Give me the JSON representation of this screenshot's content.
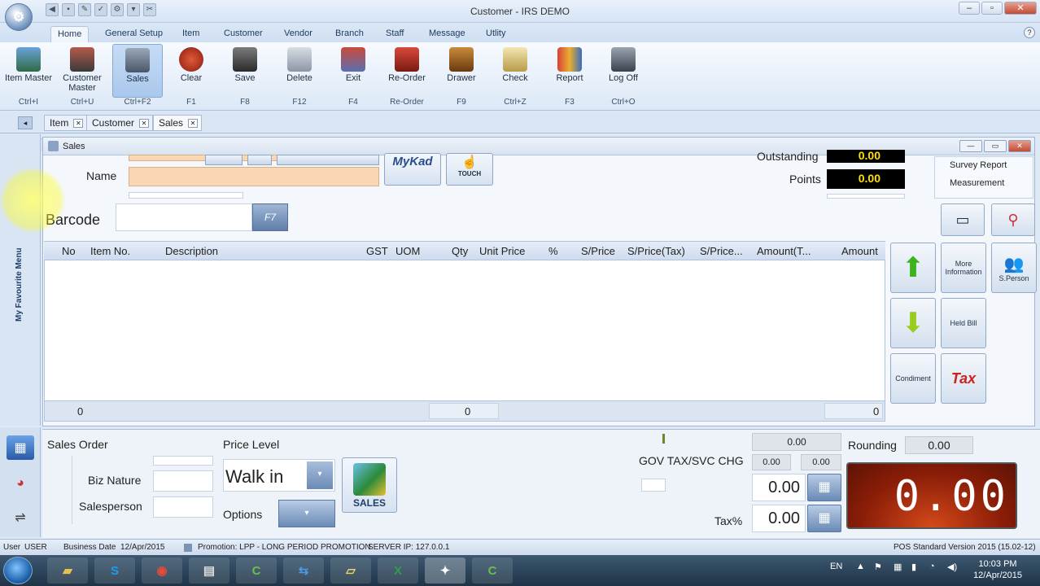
{
  "window": {
    "title": "Customer - IRS DEMO"
  },
  "ribbon_tabs": [
    "Home",
    "General Setup",
    "Item",
    "Customer",
    "Vendor",
    "Branch",
    "Staff",
    "Message",
    "Utlity"
  ],
  "ribbon_buttons": [
    {
      "label": "Item Master",
      "shortcut": "Ctrl+I"
    },
    {
      "label": "Customer Master",
      "shortcut": "Ctrl+U"
    },
    {
      "label": "Sales",
      "shortcut": "Ctrl+F2"
    },
    {
      "label": "Clear",
      "shortcut": "F1"
    },
    {
      "label": "Save",
      "shortcut": "F8"
    },
    {
      "label": "Delete",
      "shortcut": "F12"
    },
    {
      "label": "Exit",
      "shortcut": "F4"
    },
    {
      "label": "Re-Order",
      "shortcut": "Re-Order"
    },
    {
      "label": "Drawer",
      "shortcut": "F9"
    },
    {
      "label": "Check",
      "shortcut": "Ctrl+Z"
    },
    {
      "label": "Report",
      "shortcut": "F3"
    },
    {
      "label": "Log Off",
      "shortcut": "Ctrl+O"
    }
  ],
  "doc_tabs": [
    "Item",
    "Customer",
    "Sales"
  ],
  "side_menu": {
    "label": "My Favourite Menu"
  },
  "sales_window": {
    "title": "Sales",
    "name_label": "Name",
    "barcode_label": "Barcode",
    "barcode_button": "F7",
    "mykad": "MyKad",
    "touch": "TOUCH",
    "outstanding_label": "Outstanding",
    "outstanding_value": "0.00",
    "points_label": "Points",
    "points_value": "0.00",
    "links": [
      "Survey Report",
      "Measurement"
    ]
  },
  "grid": {
    "columns": [
      "No",
      "Item No.",
      "Description",
      "GST",
      "UOM",
      "Qty",
      "Unit Price",
      "%",
      "S/Price",
      "S/Price(Tax)",
      "S/Price...",
      "Amount(T...",
      "Amount"
    ],
    "footer": [
      "0",
      "0",
      "0"
    ]
  },
  "side_buttons": [
    "More Information",
    "S.Person",
    "Held Bill",
    "Condiment",
    "Tax"
  ],
  "bottom": {
    "sales_order_label": "Sales Order",
    "biz_nature_label": "Biz Nature",
    "salesperson_label": "Salesperson",
    "price_level_label": "Price Level",
    "price_level_value": "Walk in",
    "options_label": "Options",
    "sales_button": "SALES",
    "gov_tax_label": "GOV TAX/SVC CHG",
    "gov_tax_top": "0.00",
    "gov_tax_a": "0.00",
    "gov_tax_b": "0.00",
    "disc_value": "0.00",
    "tax_pct_label": "Tax%",
    "tax_pct_value": "0.00",
    "rounding_label": "Rounding",
    "rounding_value": "0.00",
    "display_total": "0.00"
  },
  "status": {
    "user_label": "User",
    "user": "USER",
    "business_date_label": "Business Date",
    "business_date": "12/Apr/2015",
    "promotion": "Promotion: LPP - LONG PERIOD PROMOTION",
    "server_ip": "SERVER IP: 127.0.0.1",
    "version": "POS Standard Version 2015 (15.02-12)"
  },
  "taskbar": {
    "lang": "EN",
    "time": "10:03 PM",
    "date": "12/Apr/2015"
  }
}
